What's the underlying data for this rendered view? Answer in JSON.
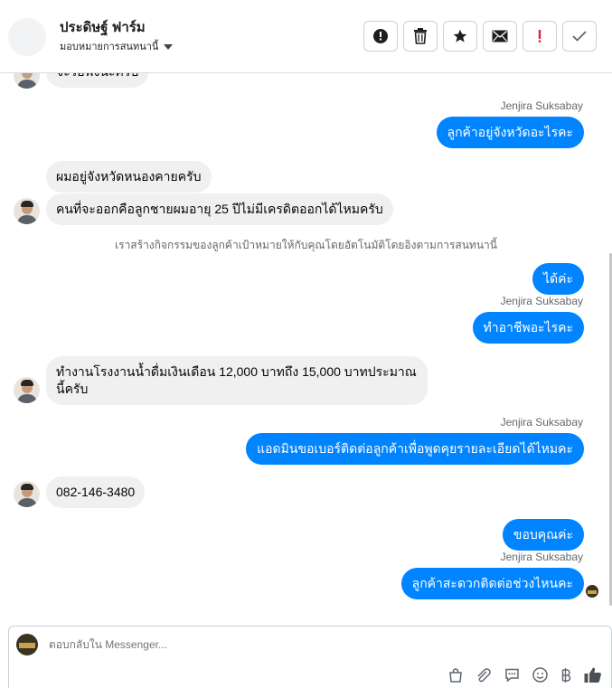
{
  "header": {
    "page_name": "ประดิษฐ์ ฟาร์ม",
    "assign_label": "มอบหมายการสนทนานี้"
  },
  "toolbar": [
    "alert-circle",
    "trash",
    "star",
    "mail",
    "exclamation",
    "check"
  ],
  "thread": {
    "cut_message": "จะรอฟังนะครับ",
    "sender_1": "Jenjira Suksabay",
    "out_1": "ลูกค้าอยู่จังหวัดอะไรคะ",
    "in_1": "ผมอยู่จังหวัดหนองคายครับ",
    "in_2": "คนที่จะออกคือลูกชายผมอายุ 25 ปีไม่มีเครดิตออกได้ไหมครับ",
    "system_note": "เราสร้างกิจกรรมของลูกค้าเป้าหมายให้กับคุณโดยอัตโนมัติโดยอิงตามการสนทนานี้",
    "out_2": "ได้ค่ะ",
    "sender_2": "Jenjira Suksabay",
    "out_3": "ทำอาชีพอะไรคะ",
    "in_3": "ทำงานโรงงานน้ำดื่มเงินเดือน 12,000 บาทถึง 15,000 บาทประมาณนี้ครับ",
    "sender_3": "Jenjira Suksabay",
    "out_4": "แอดมินขอเบอร์ติดต่อลูกค้าเพื่อพูดคุยรายละเอียดได้ไหมคะ",
    "in_4": "082-146-3480",
    "out_5": "ขอบคุณค่ะ",
    "sender_4": "Jenjira Suksabay",
    "out_6": "ลูกค้าสะดวกติดต่อช่วงไหนคะ"
  },
  "composer": {
    "placeholder": "ตอบกลับใน Messenger...",
    "tools": [
      "bag-icon",
      "paperclip-icon",
      "chat-bubble-icon",
      "emoji-icon",
      "baht-icon",
      "thumbs-up-icon"
    ]
  },
  "colors": {
    "outgoing_bubble": "#0084ff",
    "incoming_bubble": "#f0f0f0",
    "secondary_text": "#65676b"
  }
}
